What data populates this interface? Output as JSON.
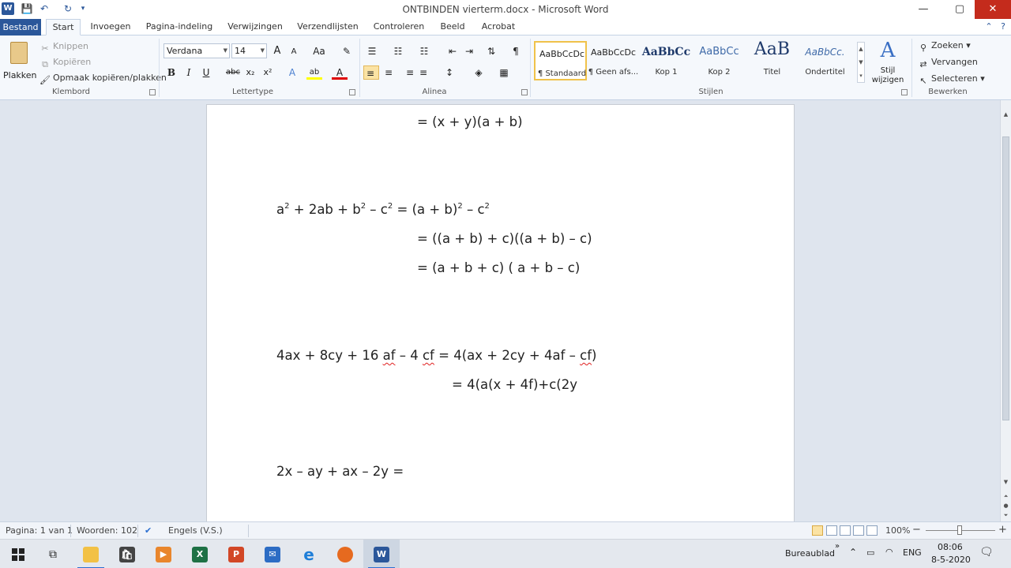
{
  "window": {
    "title": "ONTBINDEN vierterm.docx  -  Microsoft Word",
    "logo": "W",
    "controls": {
      "minimize": "—",
      "restore": "▢",
      "close": "✕"
    }
  },
  "quick_access": {
    "save_icon": "💾",
    "undo_icon": "↶",
    "redo_icon": "↻",
    "customize_icon": "▾"
  },
  "tabs": {
    "file": "Bestand",
    "items": [
      "Start",
      "Invoegen",
      "Pagina-indeling",
      "Verwijzingen",
      "Verzendlijsten",
      "Controleren",
      "Beeld",
      "Acrobat"
    ],
    "active": "Start",
    "help_icon": "?"
  },
  "ribbon": {
    "clipboard": {
      "paste": "Plakken",
      "cut": "Knippen",
      "copy": "Kopiëren",
      "format_painter": "Opmaak kopiëren/plakken",
      "label": "Klembord"
    },
    "font": {
      "family": "Verdana",
      "size": "14",
      "label": "Lettertype",
      "grow": "A",
      "shrink": "A",
      "case": "Aa",
      "clear": "✎",
      "bold": "B",
      "italic": "I",
      "underline": "U",
      "strike": "abc",
      "subscript": "x₂",
      "superscript": "x²",
      "effects": "A",
      "highlight": "ab",
      "color": "A"
    },
    "paragraph": {
      "label": "Alinea",
      "bullets": "☰",
      "numbering": "☷",
      "multilevel": "☷",
      "outdent": "⇤",
      "indent": "⇥",
      "sort": "⇅",
      "pilcrow": "¶",
      "align_left": "≡",
      "align_center": "≡",
      "align_right": "≡",
      "justify": "≡",
      "line_spacing": "↕",
      "shading": "◈",
      "borders": "▦"
    },
    "styles": {
      "label": "Stijlen",
      "items": [
        {
          "preview": "AaBbCcDc",
          "name": "¶ Standaard"
        },
        {
          "preview": "AaBbCcDc",
          "name": "¶ Geen afs..."
        },
        {
          "preview": "AaBbCc",
          "name": "Kop 1"
        },
        {
          "preview": "AaBbCc",
          "name": "Kop 2"
        },
        {
          "preview": "AaB",
          "name": "Titel"
        },
        {
          "preview": "AaBbCc.",
          "name": "Ondertitel"
        }
      ],
      "change_styles": "Stijl wijzigen",
      "change_styles_icon": "A"
    },
    "editing": {
      "label": "Bewerken",
      "find": "Zoeken",
      "replace": "Vervangen",
      "select": "Selecteren"
    }
  },
  "document": {
    "lines": {
      "l1": "= (x + y)(a + b)",
      "l2_a": "a",
      "l2_a_exp": "2",
      "l2_b": " + 2ab + b",
      "l2_b_exp": "2",
      "l2_c": " – c",
      "l2_c_exp": "2",
      "l2_d": " = (a + b)",
      "l2_d_exp": "2",
      "l2_e": " – c",
      "l2_e_exp": "2",
      "l3": "= ((a + b) + c)((a + b) – c)",
      "l4": "= (a + b + c) ( a + b – c)",
      "l5_pre": "4ax + 8cy + 16 ",
      "l5_af": "af",
      "l5_mid": " – 4 ",
      "l5_cf": "cf",
      "l5_mid2": " = 4(ax + 2cy + 4af – ",
      "l5_cf2": "cf",
      "l5_end": ")",
      "l6": "= 4(a(x + 4f)+c(2y",
      "l7": "2x – ay + ax – 2y ="
    }
  },
  "statusbar": {
    "page": "Pagina: 1 van 1",
    "words": "Woorden: 102",
    "language": "Engels (V.S.)",
    "zoom": "100%",
    "zoom_minus": "−",
    "zoom_plus": "+"
  },
  "taskbar": {
    "desktop_label": "Bureaublad",
    "language": "ENG",
    "time": "08:06",
    "date": "8-5-2020",
    "app_glyphs": {
      "excel": "X",
      "powerpoint": "P",
      "word": "W",
      "outlook": "✉",
      "ie": "e",
      "media": "▶"
    }
  }
}
